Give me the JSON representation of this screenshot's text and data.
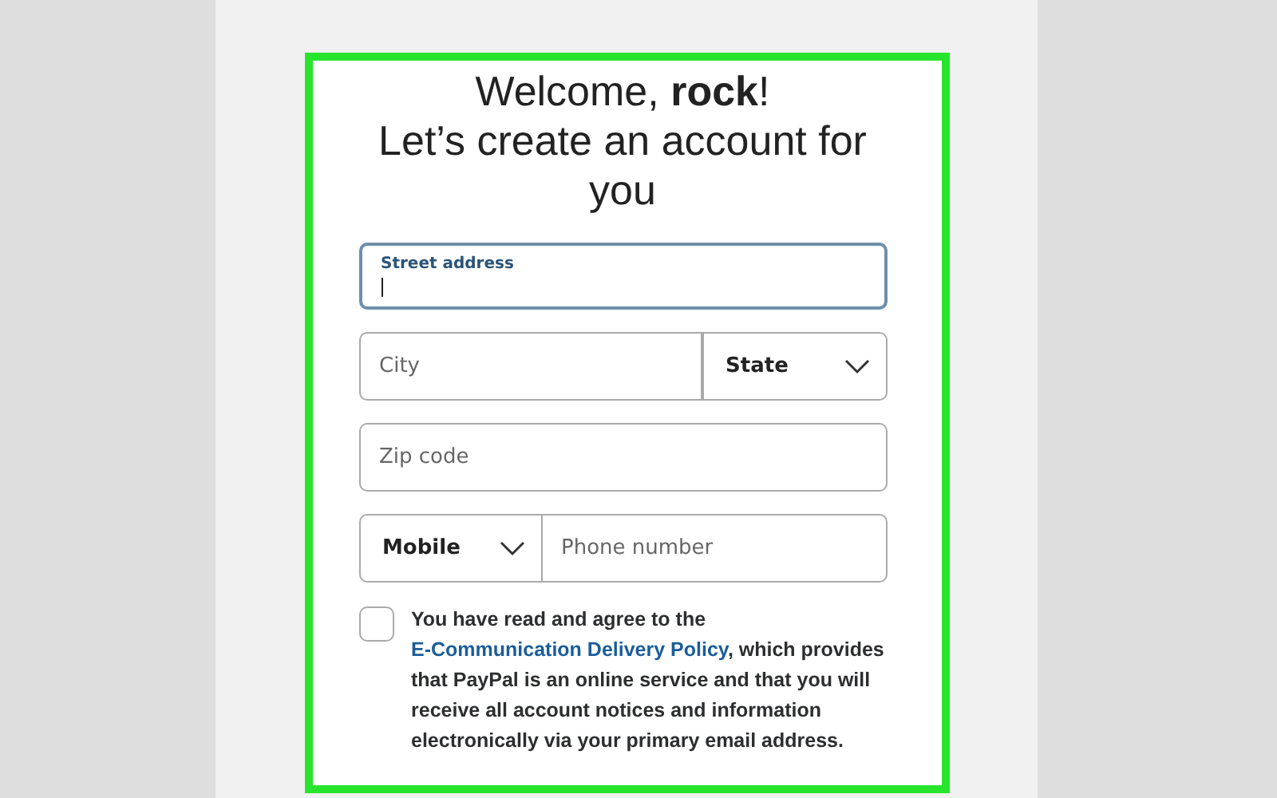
{
  "heading": [
    "Welcome, **rock**!",
    "Let’s create an account for you"
  ],
  "street_field": {
    "label": "Street address",
    "focused": true
  },
  "city_field": {
    "placeholder": "City"
  },
  "state_select": {
    "value": "State"
  },
  "zip_field": {
    "placeholder": "Zip code"
  },
  "phone_type_select": {
    "value": "Mobile"
  },
  "phone_field": {
    "placeholder": "Phone number"
  },
  "consent": {
    "checked": false,
    "text_before": "You have read and agree to the ",
    "link": "E-Communication Delivery Policy",
    "text_after": ", which provides that PayPal is an online service and that you will receive all account notices and information electronically via your primary email address."
  }
}
